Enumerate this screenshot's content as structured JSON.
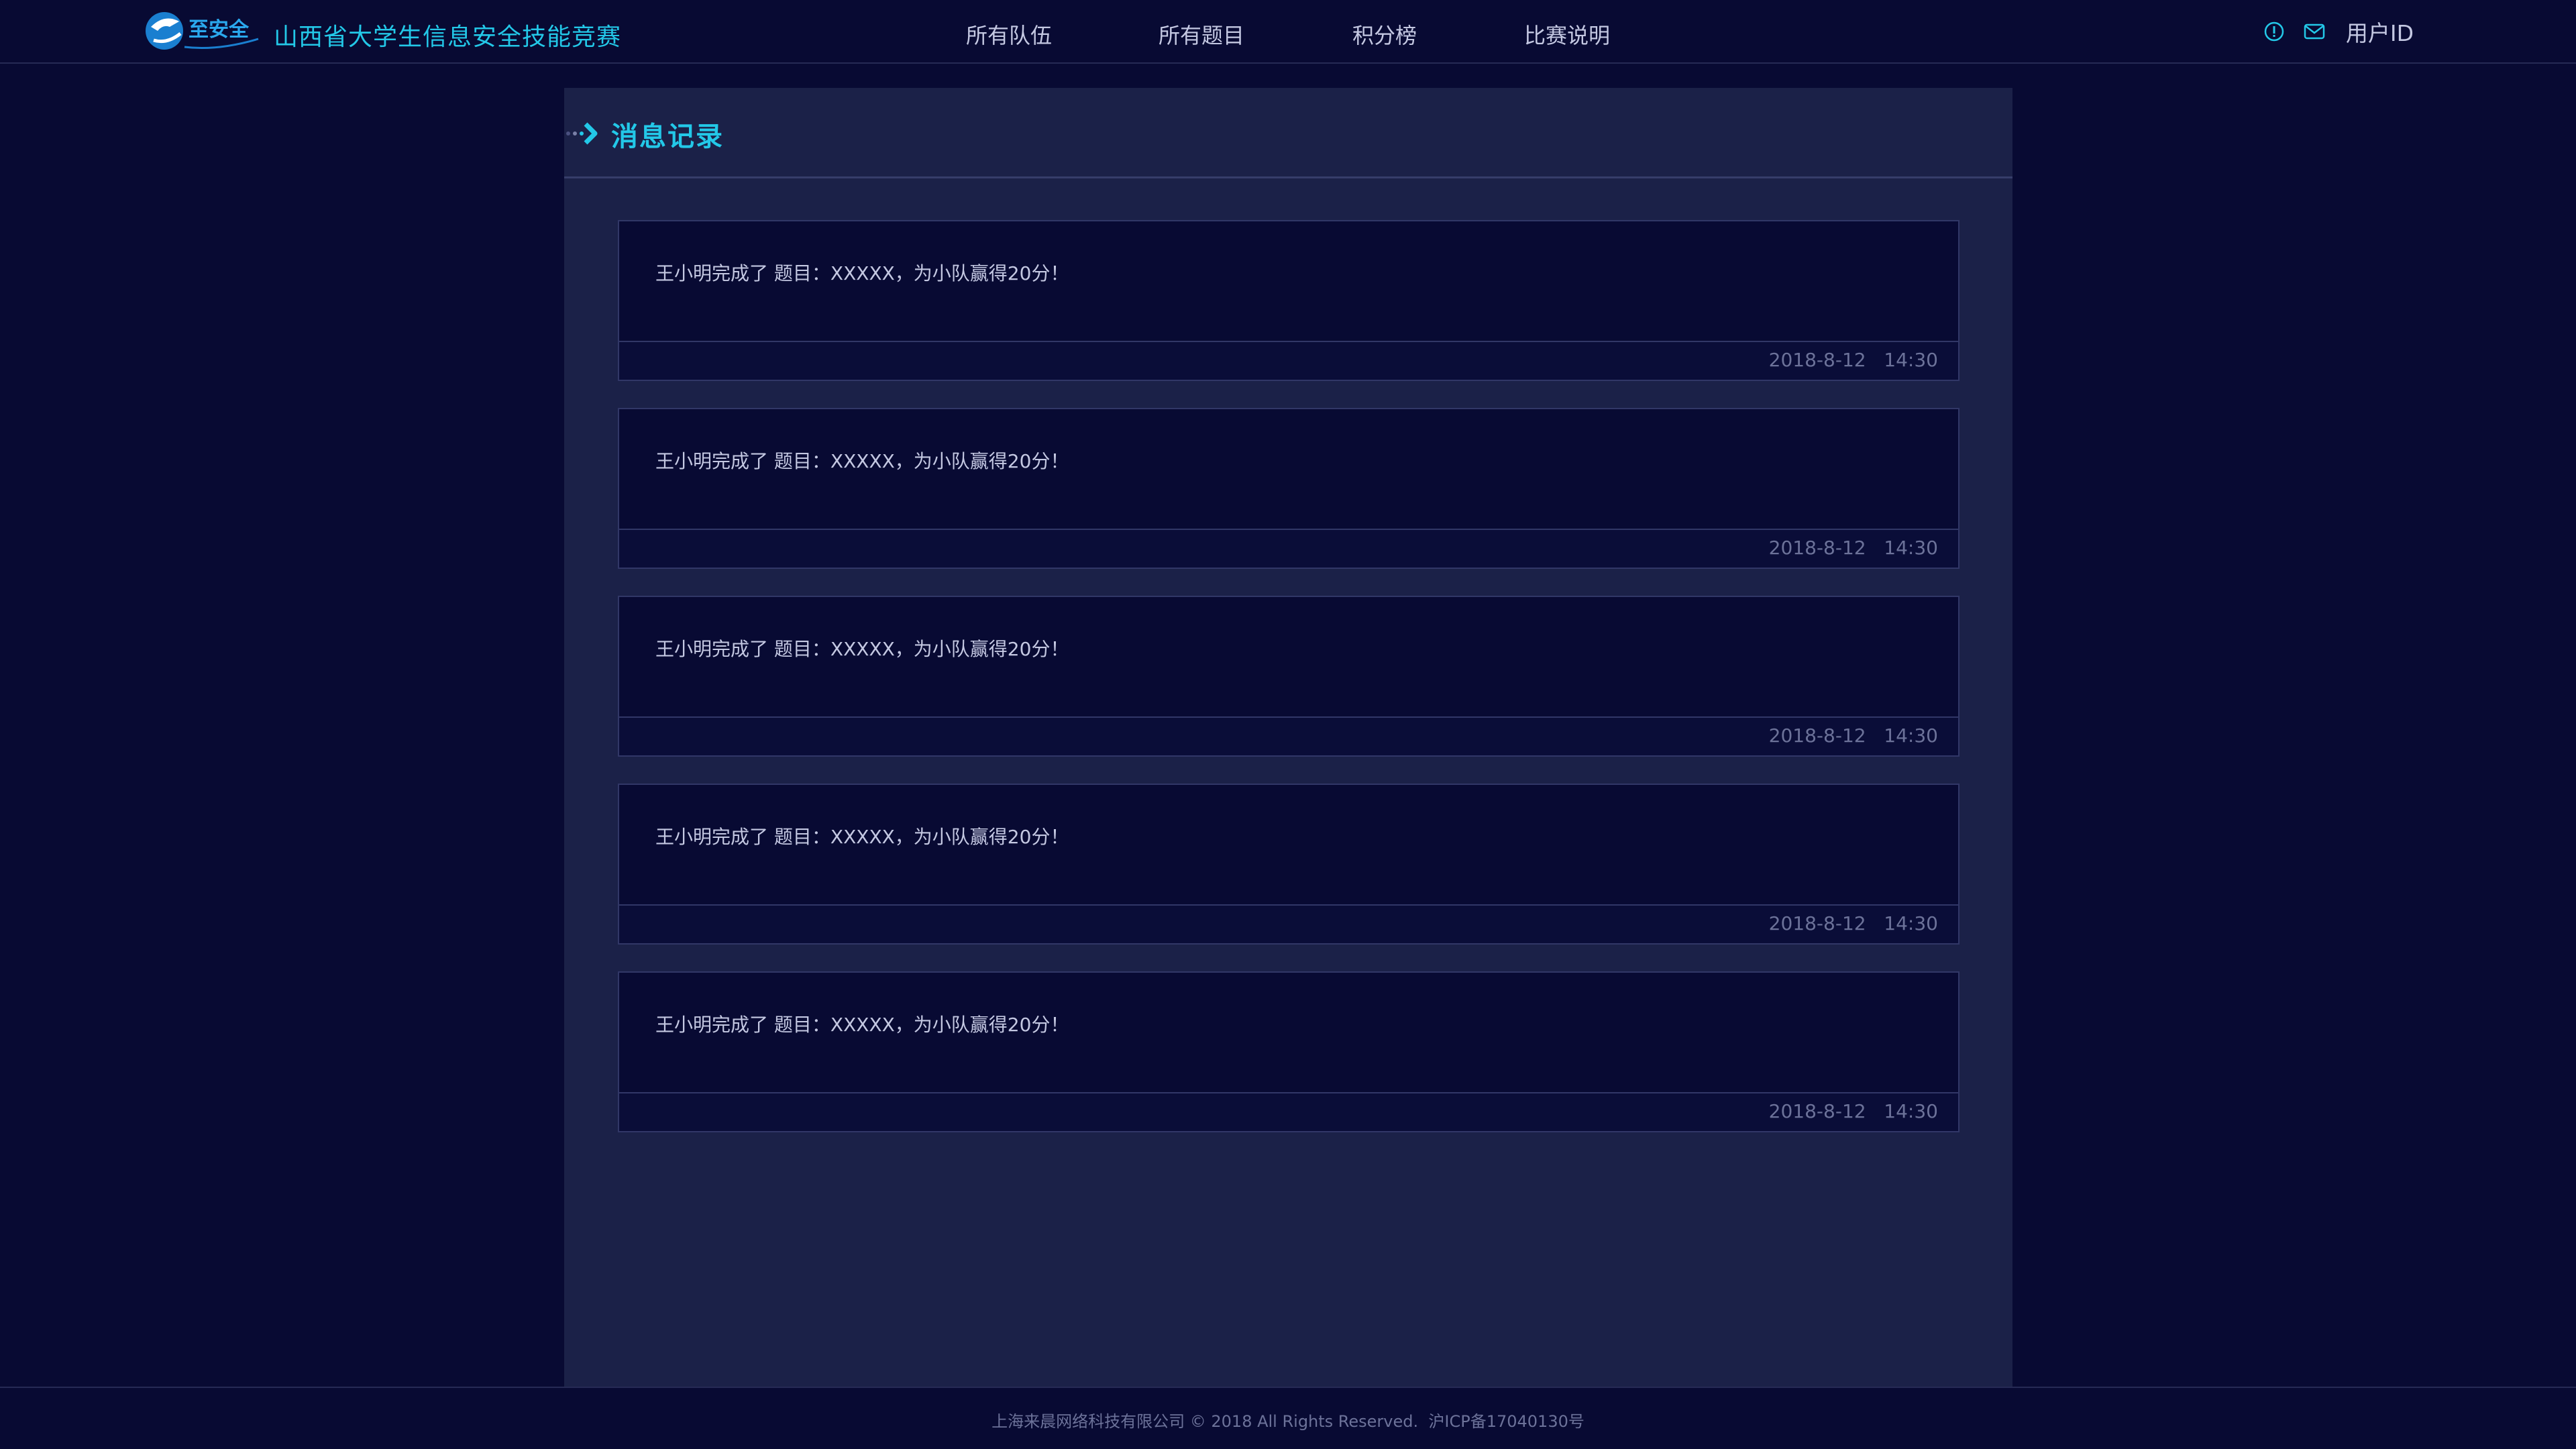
{
  "header": {
    "logo_text": "至安全",
    "site_title": "山西省大学生信息安全技能竞赛",
    "nav": [
      {
        "label": "所有队伍"
      },
      {
        "label": "所有题目"
      },
      {
        "label": "积分榜"
      },
      {
        "label": "比赛说明"
      }
    ],
    "info_icon": "info-circle-icon",
    "mail_icon": "mail-icon",
    "user_label": "用户ID"
  },
  "page": {
    "title": "消息记录",
    "title_icon": "chevron-right-icon"
  },
  "messages": [
    {
      "text": "王小明完成了 题目：XXXXX，为小队赢得20分！",
      "date": "2018-8-12",
      "time": "14:30"
    },
    {
      "text": "王小明完成了 题目：XXXXX，为小队赢得20分！",
      "date": "2018-8-12",
      "time": "14:30"
    },
    {
      "text": "王小明完成了 题目：XXXXX，为小队赢得20分！",
      "date": "2018-8-12",
      "time": "14:30"
    },
    {
      "text": "王小明完成了 题目：XXXXX，为小队赢得20分！",
      "date": "2018-8-12",
      "time": "14:30"
    },
    {
      "text": "王小明完成了 题目：XXXXX，为小队赢得20分！",
      "date": "2018-8-12",
      "time": "14:30"
    }
  ],
  "footer": {
    "copyright": "上海来晨网络科技有限公司 © 2018 All Rights Reserved.",
    "icp": "沪ICP备17040130号"
  },
  "colors": {
    "background": "#080a33",
    "panel": "#1b2148",
    "accent": "#23c8e8",
    "text": "#c4c8e2",
    "muted": "#6c7299"
  }
}
